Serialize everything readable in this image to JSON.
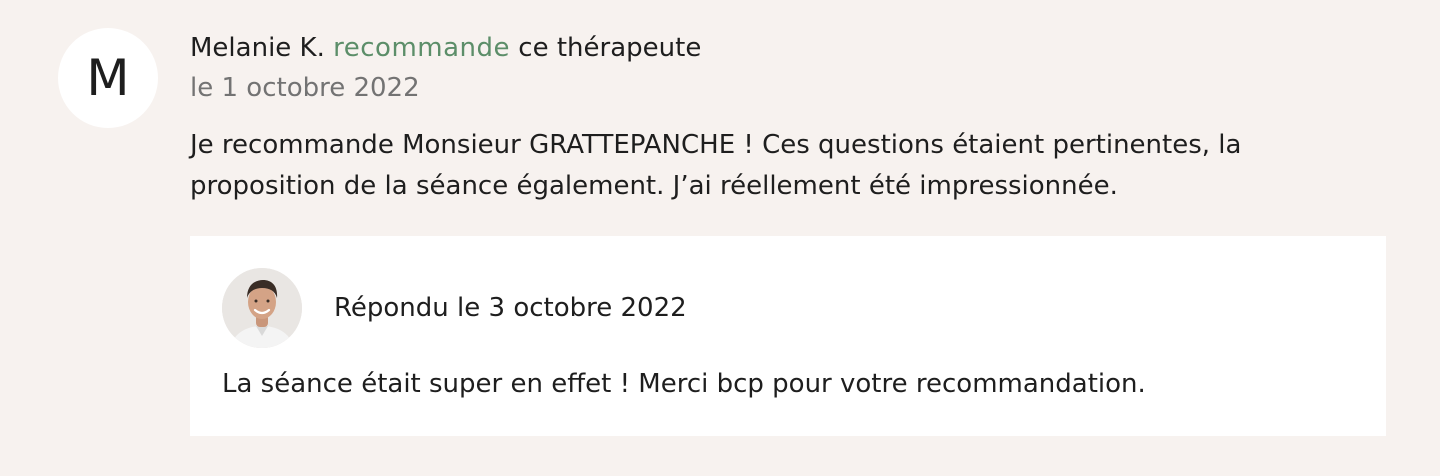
{
  "review": {
    "avatar_initial": "M",
    "author_name": "Melanie K.",
    "verb": "recommande",
    "suffix": "ce thérapeute",
    "date": "le 1 octobre 2022",
    "text": "Je recommande Monsieur GRATTEPANCHE ! Ces questions étaient pertinentes, la proposition de la séance également. J’ai réellement été impressionnée."
  },
  "reply": {
    "date": "Répondu le 3 octobre 2022",
    "text": "La séance était super en effet ! Merci bcp pour votre recommandation."
  },
  "colors": {
    "background": "#f7f2ef",
    "accent_green": "#5c8e69",
    "muted_gray": "#737373",
    "card": "#ffffff"
  }
}
